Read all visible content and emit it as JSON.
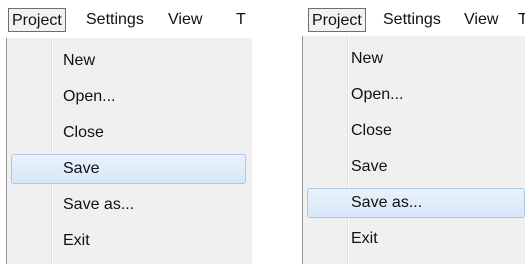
{
  "left": {
    "menubar": {
      "items": [
        "Project",
        "Settings",
        "View",
        "T"
      ]
    },
    "menu": {
      "items": [
        "New",
        "Open...",
        "Close",
        "Save",
        "Save as...",
        "Exit"
      ],
      "highlighted": "Save"
    }
  },
  "right": {
    "menubar": {
      "items": [
        "Project",
        "Settings",
        "View",
        "T"
      ]
    },
    "menu": {
      "items": [
        "New",
        "Open...",
        "Close",
        "Save",
        "Save as...",
        "Exit"
      ],
      "highlighted": "Save as..."
    }
  },
  "colors": {
    "highlight_bg": "#dbe9f9",
    "highlight_border": "#a9c9ea",
    "menu_bg": "#f0f0f0"
  }
}
